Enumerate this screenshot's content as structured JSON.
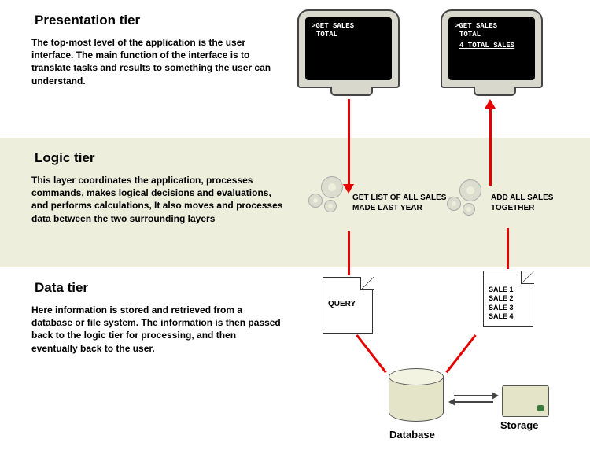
{
  "tiers": {
    "presentation": {
      "title": "Presentation tier",
      "desc": "The top-most level of the application is the user interface. The main function of the interface is to translate tasks and results to something the user can understand."
    },
    "logic": {
      "title": "Logic tier",
      "desc": "This layer coordinates the application, processes commands, makes logical decisions and evaluations, and performs calculations, It also moves and processes data between the two surrounding layers"
    },
    "data": {
      "title": "Data tier",
      "desc": "Here information is stored and retrieved from a database or file system. The information is then passed back to the logic tier for processing, and then eventually back to the user."
    }
  },
  "monitors": {
    "left": {
      "line1": ">GET SALES",
      "line2": "TOTAL"
    },
    "right": {
      "line1": ">GET SALES",
      "line2": "TOTAL",
      "result": "4 TOTAL SALES"
    }
  },
  "logic_labels": {
    "left": "GET LIST OF ALL SALES MADE LAST YEAR",
    "right": "ADD ALL SALES TOGETHER"
  },
  "documents": {
    "query": "QUERY",
    "sales": [
      "SALE 1",
      "SALE 2",
      "SALE 3",
      "SALE 4"
    ]
  },
  "db_label": "Database",
  "storage_label": "Storage"
}
